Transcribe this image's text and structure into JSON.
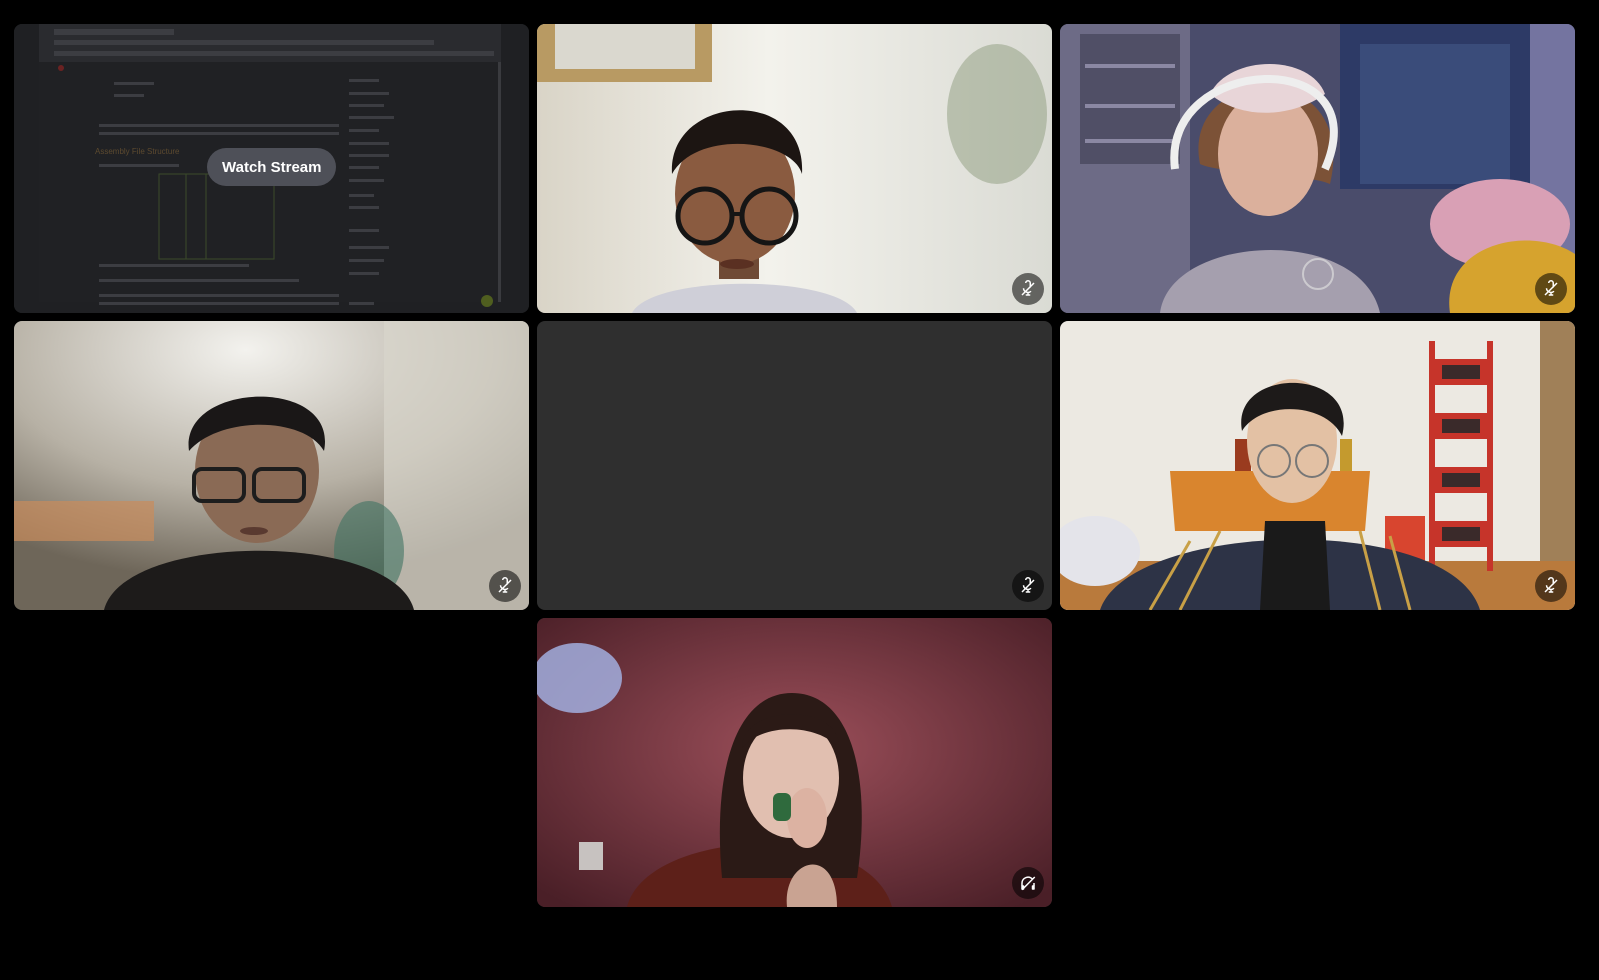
{
  "stream_tile": {
    "watch_label": "Watch Stream",
    "preview_heading": "Assembly File Structure"
  },
  "tiles": [
    {
      "id": "stream-share",
      "mute_icon": "none"
    },
    {
      "id": "participant-2",
      "mute_icon": "mic-muted-icon"
    },
    {
      "id": "participant-3",
      "mute_icon": "mic-muted-icon"
    },
    {
      "id": "participant-4",
      "mute_icon": "mic-muted-icon"
    },
    {
      "id": "participant-5-camera-off",
      "mute_icon": "mic-muted-icon"
    },
    {
      "id": "participant-6",
      "mute_icon": "mic-muted-icon"
    },
    {
      "id": "participant-7",
      "mute_icon": "deafened-icon"
    }
  ],
  "colors": {
    "background": "#000000",
    "tile_empty": "#2b2d31",
    "watch_button": "#4e5058",
    "icon_bg": "rgba(0,0,0,0.55)"
  }
}
